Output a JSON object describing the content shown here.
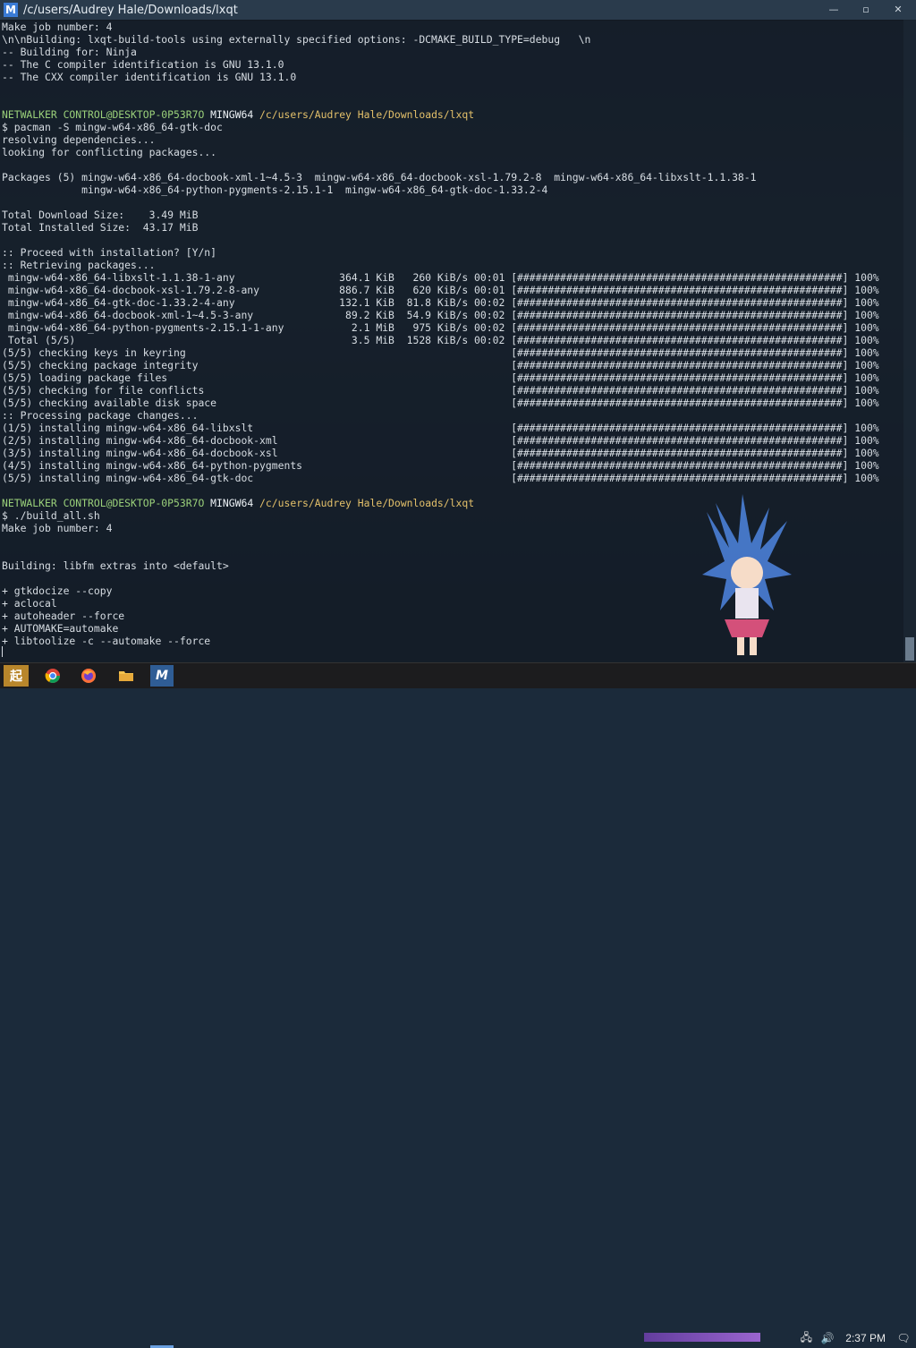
{
  "window": {
    "title": "/c/users/Audrey Hale/Downloads/lxqt",
    "app_icon_letter": "M",
    "minimize_glyph": "—",
    "maximize_glyph": "▫",
    "close_glyph": "✕"
  },
  "terminal": {
    "lines": [
      {
        "text": "Make job number: 4",
        "cls": ""
      },
      {
        "text": "\\n\\nBuilding: lxqt-build-tools using externally specified options: -DCMAKE_BUILD_TYPE=debug   \\n",
        "cls": ""
      },
      {
        "text": "-- Building for: Ninja",
        "cls": ""
      },
      {
        "text": "-- The C compiler identification is GNU 13.1.0",
        "cls": ""
      },
      {
        "text": "-- The CXX compiler identification is GNU 13.1.0",
        "cls": ""
      },
      {
        "text": "",
        "cls": ""
      },
      {
        "text": "",
        "cls": ""
      },
      {
        "text": "NETWALKER CONTROL@DESKTOP-0P53R7O MINGW64 /c/users/Audrey Hale/Downloads/lxqt",
        "cls": "prompt"
      },
      {
        "text": "$ pacman -S mingw-w64-x86_64-gtk-doc",
        "cls": ""
      },
      {
        "text": "resolving dependencies...",
        "cls": ""
      },
      {
        "text": "looking for conflicting packages...",
        "cls": ""
      },
      {
        "text": "",
        "cls": ""
      },
      {
        "text": "Packages (5) mingw-w64-x86_64-docbook-xml-1~4.5-3  mingw-w64-x86_64-docbook-xsl-1.79.2-8  mingw-w64-x86_64-libxslt-1.1.38-1",
        "cls": ""
      },
      {
        "text": "             mingw-w64-x86_64-python-pygments-2.15.1-1  mingw-w64-x86_64-gtk-doc-1.33.2-4",
        "cls": ""
      },
      {
        "text": "",
        "cls": ""
      },
      {
        "text": "Total Download Size:    3.49 MiB",
        "cls": ""
      },
      {
        "text": "Total Installed Size:  43.17 MiB",
        "cls": ""
      },
      {
        "text": "",
        "cls": ""
      },
      {
        "text": ":: Proceed with installation? [Y/n]",
        "cls": ""
      },
      {
        "text": ":: Retrieving packages...",
        "cls": ""
      },
      {
        "text": " mingw-w64-x86_64-libxslt-1.1.38-1-any                 364.1 KiB   260 KiB/s 00:01 [#####################################################] 100%",
        "cls": ""
      },
      {
        "text": " mingw-w64-x86_64-docbook-xsl-1.79.2-8-any             886.7 KiB   620 KiB/s 00:01 [#####################################################] 100%",
        "cls": ""
      },
      {
        "text": " mingw-w64-x86_64-gtk-doc-1.33.2-4-any                 132.1 KiB  81.8 KiB/s 00:02 [#####################################################] 100%",
        "cls": ""
      },
      {
        "text": " mingw-w64-x86_64-docbook-xml-1~4.5-3-any               89.2 KiB  54.9 KiB/s 00:02 [#####################################################] 100%",
        "cls": ""
      },
      {
        "text": " mingw-w64-x86_64-python-pygments-2.15.1-1-any           2.1 MiB   975 KiB/s 00:02 [#####################################################] 100%",
        "cls": ""
      },
      {
        "text": " Total (5/5)                                             3.5 MiB  1528 KiB/s 00:02 [#####################################################] 100%",
        "cls": ""
      },
      {
        "text": "(5/5) checking keys in keyring                                                     [#####################################################] 100%",
        "cls": ""
      },
      {
        "text": "(5/5) checking package integrity                                                   [#####################################################] 100%",
        "cls": ""
      },
      {
        "text": "(5/5) loading package files                                                        [#####################################################] 100%",
        "cls": ""
      },
      {
        "text": "(5/5) checking for file conflicts                                                  [#####################################################] 100%",
        "cls": ""
      },
      {
        "text": "(5/5) checking available disk space                                                [#####################################################] 100%",
        "cls": ""
      },
      {
        "text": ":: Processing package changes...",
        "cls": ""
      },
      {
        "text": "(1/5) installing mingw-w64-x86_64-libxslt                                          [#####################################################] 100%",
        "cls": ""
      },
      {
        "text": "(2/5) installing mingw-w64-x86_64-docbook-xml                                      [#####################################################] 100%",
        "cls": ""
      },
      {
        "text": "(3/5) installing mingw-w64-x86_64-docbook-xsl                                      [#####################################################] 100%",
        "cls": ""
      },
      {
        "text": "(4/5) installing mingw-w64-x86_64-python-pygments                                  [#####################################################] 100%",
        "cls": ""
      },
      {
        "text": "(5/5) installing mingw-w64-x86_64-gtk-doc                                          [#####################################################] 100%",
        "cls": ""
      },
      {
        "text": "",
        "cls": ""
      },
      {
        "text": "NETWALKER CONTROL@DESKTOP-0P53R7O MINGW64 /c/users/Audrey Hale/Downloads/lxqt",
        "cls": "prompt"
      },
      {
        "text": "$ ./build_all.sh",
        "cls": ""
      },
      {
        "text": "Make job number: 4",
        "cls": ""
      },
      {
        "text": "",
        "cls": ""
      },
      {
        "text": "",
        "cls": ""
      },
      {
        "text": "Building: libfm extras into <default>",
        "cls": ""
      },
      {
        "text": "",
        "cls": ""
      },
      {
        "text": "+ gtkdocize --copy",
        "cls": ""
      },
      {
        "text": "+ aclocal",
        "cls": ""
      },
      {
        "text": "+ autoheader --force",
        "cls": ""
      },
      {
        "text": "+ AUTOMAKE=automake",
        "cls": ""
      },
      {
        "text": "+ libtoolize -c --automake --force",
        "cls": ""
      }
    ]
  },
  "taskbar": {
    "start_glyph": "起",
    "chrome_icon": "chrome-icon",
    "firefox_icon": "firefox-icon",
    "explorer_icon": "folder-icon",
    "msys_letter": "M",
    "tray": {
      "network_glyph": "🖧",
      "volume_glyph": "🔊",
      "time": "2:37 PM",
      "notification_glyph": "🗨"
    }
  },
  "colors": {
    "prompt_user": "#9ad07a",
    "prompt_path": "#e3c06a",
    "terminal_bg": "#111821"
  }
}
